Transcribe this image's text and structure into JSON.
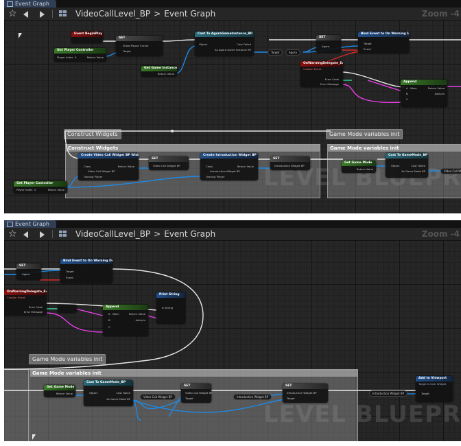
{
  "colors": {
    "exec": "#e8e8e8",
    "object": "#1e8ae6",
    "string": "#e83ee8",
    "bool": "#9a1010",
    "int": "#33d6a0",
    "struct": "#2868d8",
    "delegate": "#d82828"
  },
  "panels": [
    {
      "tab_label": "Event Graph",
      "breadcrumb": {
        "blueprint": "VideoCallLevel_BP",
        "graph": "Event Graph"
      },
      "zoom": "Zoom -4",
      "watermark": "LEVEL BLUEPRINT",
      "comments": [
        {
          "title": "Construct Widgets",
          "bubble": "Construct Widgets"
        },
        {
          "title": "Game Mode variables init",
          "bubble": "Game Mode variables init"
        }
      ],
      "nodes": {
        "begin_play": {
          "title": "Event BeginPlay"
        },
        "get_pc": {
          "title": "Get Player Controller",
          "pin_in": "Player Index",
          "pin_in_val": "0",
          "pin_out": "Return Value"
        },
        "set_cursor": {
          "title": "SET",
          "pin1": "Show Mouse Cursor",
          "pin2": "Target"
        },
        "cast_agora": {
          "title": "Cast To AgoraGameInstance_BP",
          "pin1": "Object",
          "pin2": "Cast Failed",
          "pin3": "As Agora Game Instance BP"
        },
        "get_gi": {
          "title": "Get Game Instance",
          "pin_out": "Return Value"
        },
        "var_target": {
          "label": "Target"
        },
        "var_agora": {
          "label": "Agora"
        },
        "set_agora": {
          "title": "SET",
          "pin1": "Agora"
        },
        "bind_warning": {
          "title": "Bind Event to On Warning Delegate",
          "pin1": "Target",
          "pin2": "Event"
        },
        "warning_event": {
          "title": "OnWarningDelegate_Event_1",
          "subtitle": "Custom Event",
          "pin1": "Error Code",
          "pin2": "Error Message"
        },
        "append": {
          "title": "Append",
          "pin1": "A",
          "pin1_val": "Warn",
          "pin2": "B",
          "pin3": "C",
          "pin_out": "Return Value",
          "add_pin": "Add pin"
        },
        "create_vc": {
          "title": "Create Video Call Widget BP Widget",
          "pin1": "Class",
          "pin1_val": "Video Call Widget BP",
          "pin2": "Owning Player",
          "pin_out": "Return Value"
        },
        "set_vc": {
          "title": "SET",
          "pin1": "Video Call Widget BP"
        },
        "create_intro": {
          "title": "Create Introduction Widget BP Widget",
          "pin1": "Class",
          "pin1_val": "Introduction Widget BP",
          "pin2": "Owning Player",
          "pin_out": "Return Value"
        },
        "set_intro": {
          "title": "SET",
          "pin1": "Introduction Widget BP"
        },
        "get_pc2": {
          "title": "Get Player Controller",
          "pin_in": "Player Index",
          "pin_in_val": "0",
          "pin_out": "Return Value"
        },
        "get_gm": {
          "title": "Get Game Mode",
          "pin_out": "Return Value"
        },
        "cast_gm": {
          "title": "Cast To GameMode_BP",
          "pin1": "Object",
          "pin2": "Cast Failed",
          "pin3": "As Game Mode BP"
        },
        "var_vc": {
          "label": "Video Call Widget"
        }
      }
    },
    {
      "tab_label": "Event Graph",
      "breadcrumb": {
        "blueprint": "VideoCallLevel_BP",
        "graph": "Event Graph"
      },
      "zoom": "Zoom -4",
      "watermark": "LEVEL BLUEPRINT",
      "comments": [
        {
          "title": "Game Mode variables init",
          "bubble": "Game Mode variables init"
        }
      ],
      "nodes": {
        "set_agora": {
          "title": "SET",
          "pin1": "Agora"
        },
        "bind_warning": {
          "title": "Bind Event to On Warning Delegate",
          "pin1": "Target",
          "pin2": "Event"
        },
        "warning_event": {
          "title": "OnWarningDelegate_Event_1",
          "subtitle": "Custom Event",
          "pin1": "Error Code",
          "pin2": "Error Message"
        },
        "append": {
          "title": "Append",
          "pin1": "A",
          "pin1_val": "Warn",
          "pin2": "B",
          "pin3": "C",
          "pin_out": "Return Value",
          "add_pin": "Add pin"
        },
        "print": {
          "title": "Print String",
          "pin1": "In String"
        },
        "get_gm": {
          "title": "Get Game Mode",
          "pin_out": "Return Value"
        },
        "cast_gm": {
          "title": "Cast To GameMode_BP",
          "pin1": "Object",
          "pin2": "Cast Failed",
          "pin3": "As Game Mode BP"
        },
        "var_vc": {
          "label": "Video Call Widget BP"
        },
        "set_vc": {
          "title": "SET",
          "pin1": "Video Call Widget BP",
          "pin2": "Target"
        },
        "var_intro": {
          "label": "Introduction Widget BP"
        },
        "set_intro": {
          "title": "SET",
          "pin1": "Introduction Widget BP",
          "pin2": "Target"
        },
        "var_intro2": {
          "label": "Introduction Widget BP"
        },
        "add_vp": {
          "title": "Add to Viewport",
          "subtitle": "Target is User Widget",
          "pin1": "Target"
        }
      }
    }
  ]
}
